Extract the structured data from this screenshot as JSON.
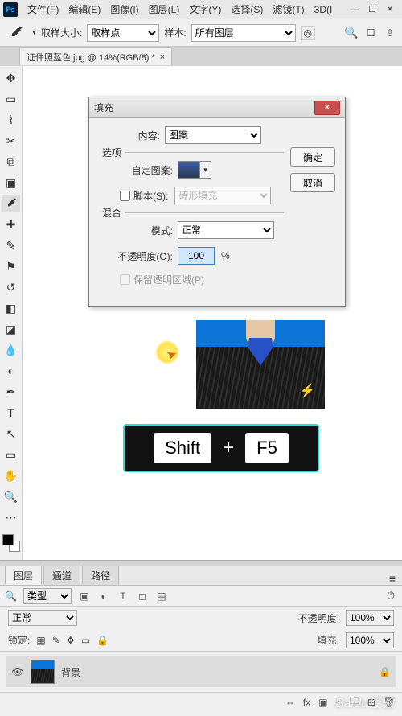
{
  "menubar": {
    "items": [
      "文件(F)",
      "编辑(E)",
      "图像(I)",
      "图层(L)",
      "文字(Y)",
      "选择(S)",
      "滤镜(T)",
      "3D(I"
    ]
  },
  "options": {
    "sample_size_label": "取样大小:",
    "sample_size_value": "取样点",
    "sample_label": "样本:",
    "sample_value": "所有图层"
  },
  "document": {
    "tab_title": "证件照蓝色.jpg @ 14%(RGB/8) *"
  },
  "dialog": {
    "title": "填充",
    "content_label": "内容:",
    "content_value": "图案",
    "ok_label": "确定",
    "cancel_label": "取消",
    "options_legend": "选项",
    "custom_pattern_label": "自定图案:",
    "script_label": "脚本(S):",
    "script_value": "砖形填充",
    "blend_legend": "混合",
    "mode_label": "模式:",
    "mode_value": "正常",
    "opacity_label": "不透明度(O):",
    "opacity_value": "100",
    "opacity_unit": "%",
    "preserve_label": "保留透明区域(P)"
  },
  "hotkey": {
    "key1": "Shift",
    "plus": "+",
    "key2": "F5"
  },
  "panels": {
    "tabs": [
      "图层",
      "通道",
      "路径"
    ],
    "search_placeholder": "类型",
    "blend_mode": "正常",
    "opacity_label": "不透明度:",
    "opacity_value": "100%",
    "lock_label": "锁定:",
    "fill_label": "填充:",
    "fill_value": "100%",
    "layer_name": "背景"
  },
  "watermark": "Baidu经验"
}
